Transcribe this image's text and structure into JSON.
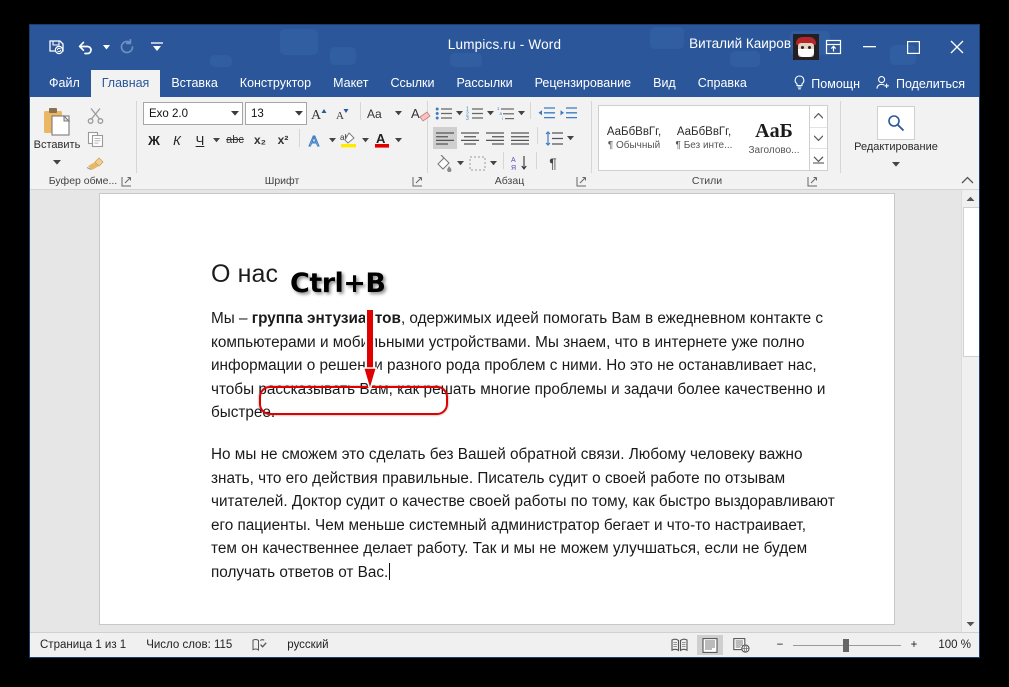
{
  "window": {
    "title": "Lumpics.ru  -  Word",
    "user_name": "Виталий Каиров",
    "minimize_label": "—",
    "maximize_label": "▢",
    "close_label": "✕"
  },
  "quick_access": [
    {
      "name": "save-icon",
      "label": "Сохранить"
    },
    {
      "name": "undo-icon",
      "label": "Отменить"
    },
    {
      "name": "redo-icon",
      "label": "Вернуть"
    },
    {
      "name": "customize-qat-icon",
      "label": "Настройка панели быстрого доступа"
    }
  ],
  "tabs": [
    {
      "label": "Файл",
      "active": false
    },
    {
      "label": "Главная",
      "active": true
    },
    {
      "label": "Вставка",
      "active": false
    },
    {
      "label": "Конструктор",
      "active": false
    },
    {
      "label": "Макет",
      "active": false
    },
    {
      "label": "Ссылки",
      "active": false
    },
    {
      "label": "Рассылки",
      "active": false
    },
    {
      "label": "Рецензирование",
      "active": false
    },
    {
      "label": "Вид",
      "active": false
    },
    {
      "label": "Справка",
      "active": false
    }
  ],
  "tabs_right": {
    "tell_me": "Помощн",
    "share": "Поделиться"
  },
  "ribbon": {
    "clipboard": {
      "group_label": "Буфер обме...",
      "paste_label": "Вставить",
      "cut_label": "Вырезать",
      "copy_label": "Копировать",
      "format_painter_label": "Формат по образцу"
    },
    "font": {
      "group_label": "Шрифт",
      "font_name": "Exo 2.0",
      "font_size": "13",
      "grow_label": "A",
      "shrink_label": "A",
      "case_label": "Aa",
      "clear_label": "A",
      "bold_label": "Ж",
      "italic_label": "К",
      "underline_label": "Ч",
      "strike_label": "abc",
      "subscript_label": "x₂",
      "superscript_label": "x²",
      "effects_label": "A",
      "highlight_label": "ab",
      "color_label": "A"
    },
    "paragraph": {
      "group_label": "Абзац"
    },
    "styles": {
      "group_label": "Стили",
      "items": [
        {
          "preview": "АаБбВвГг,",
          "name": "¶ Обычный"
        },
        {
          "preview": "АаБбВвГг,",
          "name": "¶ Без инте..."
        },
        {
          "preview": "AaБ",
          "name": "Заголово..."
        }
      ]
    },
    "editing": {
      "group_label": "Редактирование",
      "button_label": "Редактирование"
    }
  },
  "document": {
    "heading": "О нас",
    "paragraph1_before": "Мы – ",
    "paragraph1_bold": "группа энтузиастов",
    "paragraph1_after": ", одержимых идеей помогать Вам в ежедневном контакте с компьютерами и мобильными устройствами. Мы знаем, что в интернете уже полно информации о решении разного рода проблем с ними. Но это не останавливает нас, чтобы рассказывать Вам, как решать многие проблемы и задачи более качественно и быстрее.",
    "paragraph2": "Но мы не сможем это сделать без Вашей обратной связи. Любому человеку важно знать, что его действия правильные. Писатель судит о своей работе по отзывам читателей. Доктор судит о качестве своей работы по тому, как быстро выздоравливают его пациенты. Чем меньше системный администратор бегает и что-то настраивает, тем он качественнее делает работу. Так и мы не можем улучшаться, если не будем получать ответов от Вас."
  },
  "annotation": {
    "callout_text": "Ctrl+B",
    "callout_color": "#c00000",
    "highlight_color": "#e00000"
  },
  "status": {
    "page": "Страница 1 из 1",
    "words": "Число слов: 115",
    "language": "русский",
    "zoom": "100 %",
    "zoom_out_label": "−",
    "zoom_in_label": "+",
    "view_read_label": "Режим чтения",
    "view_print_label": "Разметка страницы",
    "view_web_label": "Веб-документ"
  }
}
